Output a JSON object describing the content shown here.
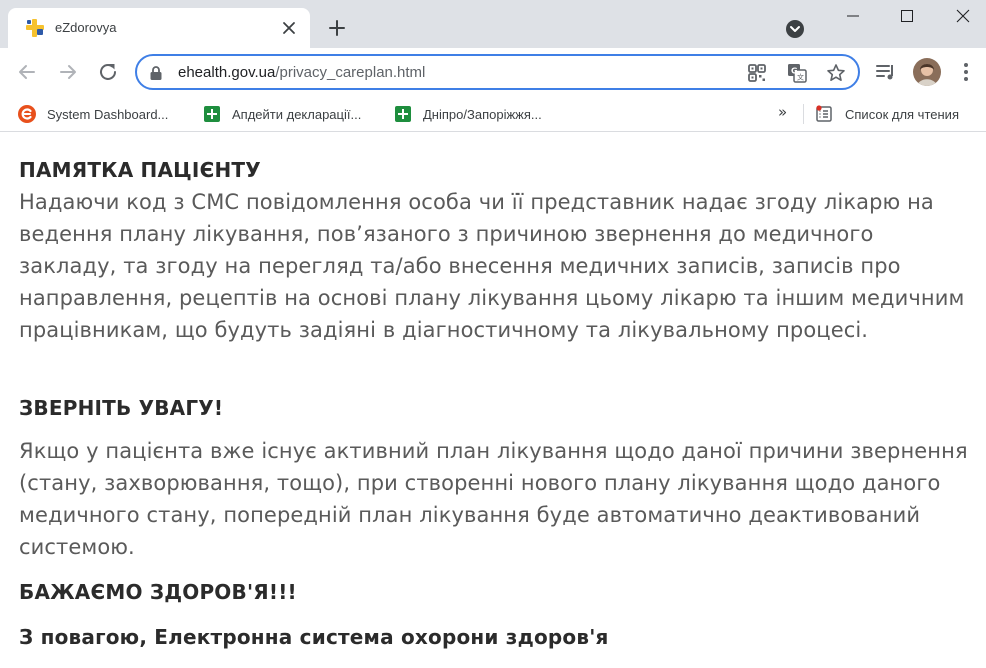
{
  "browser": {
    "tab": {
      "title": "eZdorovya"
    },
    "url": {
      "host": "ehealth.gov.ua",
      "path": "/privacy_careplan.html"
    },
    "bookmarks": [
      {
        "label": "System Dashboard..."
      },
      {
        "label": "Апдейти декларації..."
      },
      {
        "label": "Дніпро/Запоріжжя..."
      }
    ],
    "bookmarks_overflow": "»",
    "reading_list": {
      "label": "Список для чтения"
    }
  },
  "page": {
    "heading1": "ПАМЯТКА ПАЦІЄНТУ",
    "paragraph1": "Надаючи код з СМС повідомлення особа чи її представник надає згоду лікарю на ведення плану лікування, пов’язаного з причиною звернення до медичного закладу, та згоду на перегляд та/або внесення медичних записів, записів про направлення, рецептів на основі плану лікування цьому лікарю та іншим медичним працівникам, що будуть задіяні в діагностичному та лікувальному процесі.",
    "heading2": "ЗВЕРНІТЬ УВАГУ!",
    "paragraph2": "Якщо у пацієнта вже існує активний план лікування щодо даної причини звернення (стану, захворювання, тощо), при створенні нового плану лікування щодо даного медичного стану, попередній план лікування буде автоматично деактивований системою.",
    "heading3": "БАЖАЄМО ЗДОРОВ'Я!!!",
    "signature": "З повагою, Електронна система охорони здоров'я"
  },
  "colors": {
    "accent": "#3f7fe6",
    "tabstrip": "#dee1e6",
    "favicon_yellow": "#f6c22f",
    "favicon_blue": "#2e5aa8",
    "bookmark_green": "#1e8e3e",
    "bookmark_orange": "#e8501c"
  },
  "icons": {
    "tab_favicon": "ezdorovya-logo-icon",
    "lock": "lock-icon",
    "apps": "qr-code-icon",
    "translate": "translate-icon",
    "star": "star-icon",
    "media": "media-control-icon",
    "menu": "kebab-menu-icon"
  }
}
